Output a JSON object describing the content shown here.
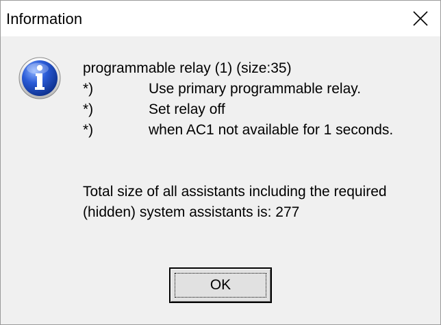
{
  "window": {
    "title": "Information",
    "close_icon": "close-icon"
  },
  "icon": {
    "name": "info-icon",
    "glyph": "i",
    "colors": {
      "circle": "#2a5bd7",
      "glyph": "#ffffff"
    }
  },
  "message": {
    "heading": "programmable relay (1) (size:35)",
    "items": [
      {
        "bullet": "*)",
        "text": "Use primary programmable relay."
      },
      {
        "bullet": "*)",
        "text": "Set relay off"
      },
      {
        "bullet": "*)",
        "text": "when AC1 not available for 1 seconds."
      }
    ],
    "summary_line1": "Total size of all assistants including the required",
    "summary_line2": "(hidden) system assistants is: 277"
  },
  "buttons": {
    "ok_label": "OK"
  }
}
